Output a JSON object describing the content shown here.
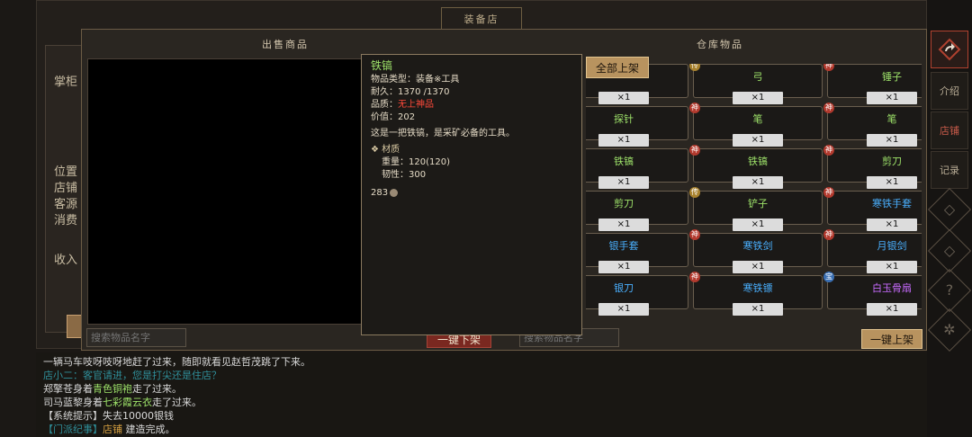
{
  "background": {
    "shop_title": "装备店",
    "labels": [
      "掌柜",
      "位置",
      "店铺",
      "客源",
      "消费",
      "收入"
    ]
  },
  "nav": {
    "items": [
      "介绍",
      "店铺",
      "记录"
    ]
  },
  "dialog": {
    "sell_title": "出售商品",
    "warehouse_title": "仓库物品",
    "sell_search_placeholder": "搜索物品名字",
    "warehouse_search_placeholder": "搜索物品名字",
    "unlist_all_label": "一键下架",
    "list_all_top_label": "全部上架",
    "list_all_bottom_label": "一键上架"
  },
  "warehouse": {
    "items": [
      {
        "name": "",
        "qty": "×1",
        "color": "#9ee36a",
        "badge": "神"
      },
      {
        "name": "弓",
        "qty": "×1",
        "color": "#9ee36a",
        "badge": "传"
      },
      {
        "name": "锤子",
        "qty": "×1",
        "color": "#9ee36a",
        "badge": "神"
      },
      {
        "name": "探针",
        "qty": "×1",
        "color": "#9ee36a",
        "badge": ""
      },
      {
        "name": "笔",
        "qty": "×1",
        "color": "#9ee36a",
        "badge": "神"
      },
      {
        "name": "笔",
        "qty": "×1",
        "color": "#9ee36a",
        "badge": "神"
      },
      {
        "name": "铁镐",
        "qty": "×1",
        "color": "#9ee36a",
        "badge": ""
      },
      {
        "name": "铁镐",
        "qty": "×1",
        "color": "#9ee36a",
        "badge": "神"
      },
      {
        "name": "剪刀",
        "qty": "×1",
        "color": "#9ee36a",
        "badge": "神"
      },
      {
        "name": "剪刀",
        "qty": "×1",
        "color": "#9ee36a",
        "badge": ""
      },
      {
        "name": "铲子",
        "qty": "×1",
        "color": "#9ee36a",
        "badge": "传"
      },
      {
        "name": "寒铁手套",
        "qty": "×1",
        "color": "#4ab0ff",
        "badge": "神"
      },
      {
        "name": "银手套",
        "qty": "×1",
        "color": "#4ab0ff",
        "badge": ""
      },
      {
        "name": "寒铁剑",
        "qty": "×1",
        "color": "#4ab0ff",
        "badge": "神"
      },
      {
        "name": "月银剑",
        "qty": "×1",
        "color": "#4ab0ff",
        "badge": "神"
      },
      {
        "name": "银刀",
        "qty": "×1",
        "color": "#4ab0ff",
        "badge": ""
      },
      {
        "name": "寒铁镖",
        "qty": "×1",
        "color": "#4ab0ff",
        "badge": "神"
      },
      {
        "name": "白玉骨扇",
        "qty": "×1",
        "color": "#c86bff",
        "badge": "宝"
      }
    ]
  },
  "tooltip": {
    "name": "铁镐",
    "type": "物品类型：装备※工具",
    "durability": "耐久：1370 /1370",
    "quality_label": "品质：",
    "quality_value": "无上神品",
    "value": "价值：202",
    "desc": "这是一把铁镐，是采矿必备的工具。",
    "material_title": "材质",
    "weight": "重量：120(120)",
    "toughness": "韧性：300",
    "price": "283"
  },
  "log": [
    {
      "parts": [
        {
          "text": "一辆马车吱呀吱呀地赶了过来，随即就看见赵哲茂跳了下来。",
          "color": "#d8d8d8"
        }
      ]
    },
    {
      "parts": [
        {
          "text": "店小二：客官请进，您是打尖还是住店？",
          "color": "#2f8f9a"
        }
      ]
    },
    {
      "parts": [
        {
          "text": "郑擎苍身着",
          "color": "#d8d8d8"
        },
        {
          "text": "青色铜袍",
          "color": "#9ee36a"
        },
        {
          "text": "走了过来。",
          "color": "#d8d8d8"
        }
      ]
    },
    {
      "parts": [
        {
          "text": "司马蓝黎身着",
          "color": "#d8d8d8"
        },
        {
          "text": "七彩霞云衣",
          "color": "#9ee36a"
        },
        {
          "text": "走了过来。",
          "color": "#d8d8d8"
        }
      ]
    },
    {
      "parts": [
        {
          "text": "【系统提示】失去10000银钱",
          "color": "#d8d8d8"
        }
      ]
    },
    {
      "parts": [
        {
          "text": "【门派纪事】",
          "color": "#2f8f9a"
        },
        {
          "text": "店铺",
          "color": "#d6a040"
        },
        {
          "text": " 建造完成。",
          "color": "#d8d8d8"
        }
      ]
    }
  ]
}
